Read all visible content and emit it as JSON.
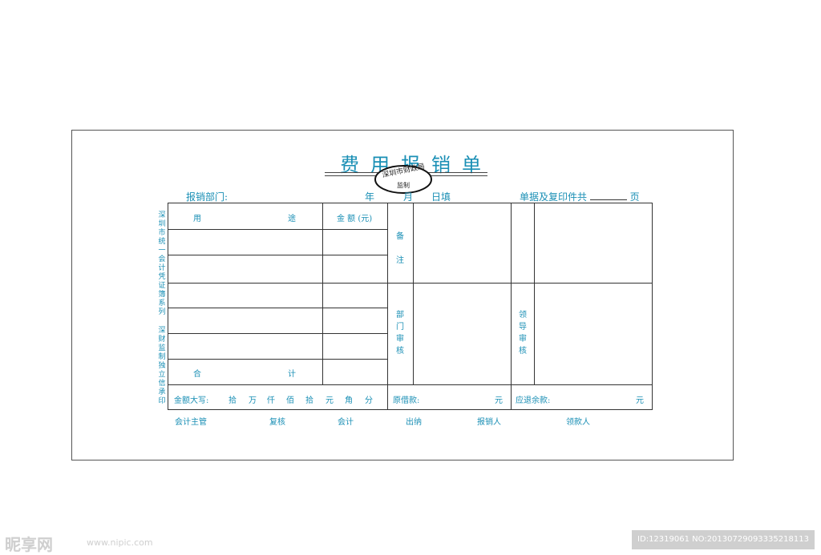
{
  "form": {
    "title": "费用报销单",
    "stamp_line1": "深圳市财政局",
    "stamp_line2": "监制",
    "header": {
      "dept_label": "报销部门:",
      "year": "年",
      "month": "月",
      "day_fill": "日填",
      "attach_label": "单据及复印件共",
      "page_unit": "页"
    },
    "left_side_text_1": "深圳市统一会计凭证簿系列",
    "left_side_text_2": "深财监制独立信承印",
    "table": {
      "col_purpose_1": "用",
      "col_purpose_2": "途",
      "col_amount": "金 额 (元)",
      "remark": "备注",
      "dept_review": "部门审核",
      "leader_review": "领导审核",
      "total_1": "合",
      "total_2": "计",
      "amount_caps_label": "金额大写:",
      "caps_units": [
        "拾",
        "万",
        "仟",
        "佰",
        "拾",
        "元",
        "角",
        "分"
      ],
      "original_loan_label": "原借款:",
      "original_loan_unit": "元",
      "refund_label": "应退余款:",
      "refund_unit": "元"
    },
    "signatures": [
      "会计主管",
      "复核",
      "会计",
      "出纳",
      "报销人",
      "领款人"
    ]
  },
  "watermark": {
    "brand": "昵享网",
    "url": "www.nipic.com",
    "id_text": "ID:12319061 NO:20130729093335218113"
  },
  "colors": {
    "accent": "#1a8fb5",
    "line": "#333333",
    "watermark": "#cfcfcf"
  }
}
